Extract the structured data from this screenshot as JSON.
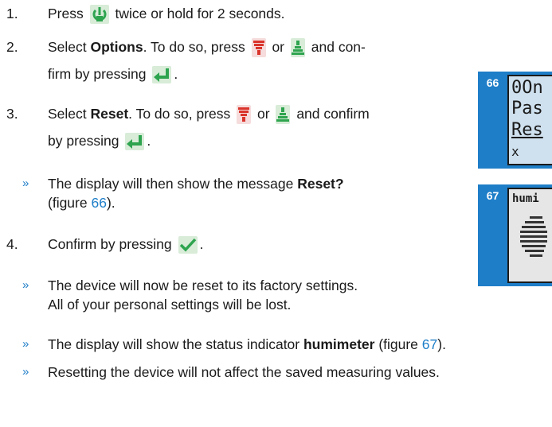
{
  "steps": [
    {
      "number": "1.",
      "pre": "Press",
      "mid": "twice or hold for 2 seconds."
    },
    {
      "number": "2.",
      "pre": "Select ",
      "bold": "Options",
      "mid": ". To do so, press",
      "or": "or",
      "post": "and con-",
      "line2": "firm by pressing",
      "end": "."
    },
    {
      "number": "3.",
      "pre": "Select ",
      "bold": "Reset",
      "mid": ". To do so, press",
      "or": "or",
      "post": "and confirm",
      "line2": "by pressing",
      "end": "."
    },
    {
      "number": "4.",
      "pre": "Confirm by pressing",
      "end": "."
    }
  ],
  "results": [
    {
      "marker": "»",
      "line1_pre": "The display will then show the message ",
      "line1_bold": "Reset?",
      "line2_pre": "(figure ",
      "ref": "66",
      "line2_post": ")."
    },
    {
      "marker": "»",
      "line1": "The device will now be reset to its factory settings.",
      "line2": "All of your personal settings will be lost."
    },
    {
      "marker": "»",
      "pre": "The display will show the status indicator ",
      "bold": "humimeter",
      "mid": " (figure ",
      "ref": "67",
      "post": ")."
    },
    {
      "marker": "»",
      "text": "Resetting the device will not affect the saved measuring values."
    }
  ],
  "figures": [
    {
      "label": "66",
      "lines": [
        "0On",
        "Pas",
        "Res",
        "x"
      ]
    },
    {
      "label": "67",
      "lines": [
        "humi"
      ]
    }
  ],
  "icons": {
    "power": "power-icon",
    "down": "arrow-down-icon",
    "up": "arrow-up-icon",
    "enter": "enter-icon",
    "confirm": "checkmark-icon"
  },
  "colors": {
    "accent": "#1e7ec8",
    "icon_green": "#2ea44f",
    "icon_red": "#d9342b",
    "lcd_bg": "#cfe0ee"
  }
}
